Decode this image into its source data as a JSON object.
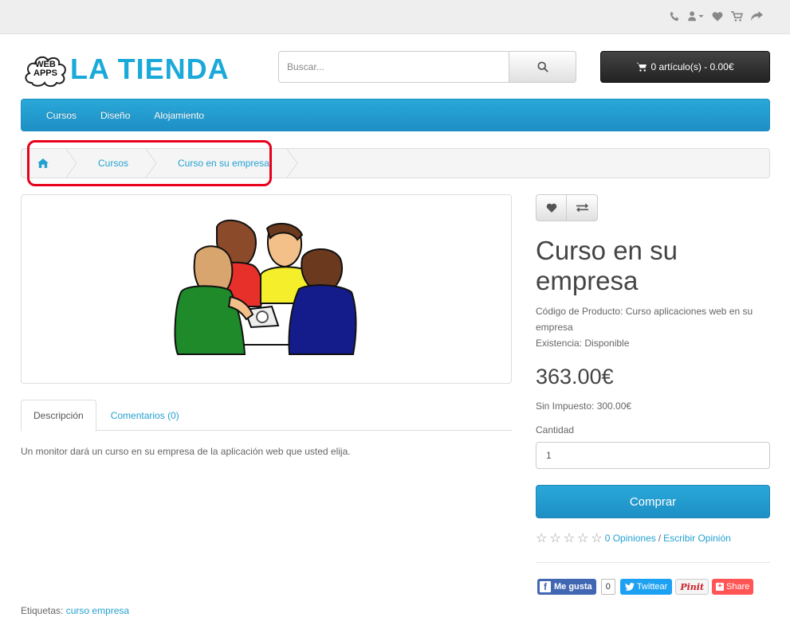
{
  "topbar": {
    "icons": [
      "phone-icon",
      "user-icon",
      "heart-icon",
      "cart-icon",
      "share-icon"
    ]
  },
  "logo": {
    "cloud_line1": "WEB",
    "cloud_line2": "APPS",
    "brand": "LA TIENDA",
    "brand_color": "#1ba9d9"
  },
  "search": {
    "placeholder": "Buscar..."
  },
  "cart": {
    "label": "0 artículo(s) - 0.00€"
  },
  "menu": {
    "items": [
      "Cursos",
      "Diseño",
      "Alojamiento"
    ]
  },
  "breadcrumb": {
    "items": [
      "Cursos",
      "Curso en su empresa"
    ]
  },
  "tabs": {
    "description": "Descripción",
    "comments": "Comentarios (0)"
  },
  "description": "Un monitor dará un curso en su empresa de la aplicación web que usted elija.",
  "tags": {
    "label": "Etiquetas:",
    "value": "curso empresa"
  },
  "product": {
    "title": "Curso en su empresa",
    "code_line": "Código de Producto: Curso aplicaciones web en su empresa",
    "stock_line": "Existencia: Disponible",
    "price": "363.00€",
    "tax_line": "Sin Impuesto: 300.00€",
    "quantity_label": "Cantidad",
    "quantity_value": "1",
    "buy_label": "Comprar",
    "reviews_link": "0 Opiniones",
    "review_sep": "/",
    "write_review": "Escribir Opinión",
    "rating": 0
  },
  "social": {
    "like": "Me gusta",
    "like_count": "0",
    "tweet": "Twittear",
    "pin": "Pinit",
    "share": "Share"
  },
  "colors": {
    "accent": "#23a1d1",
    "highlight": "#e8001c"
  }
}
